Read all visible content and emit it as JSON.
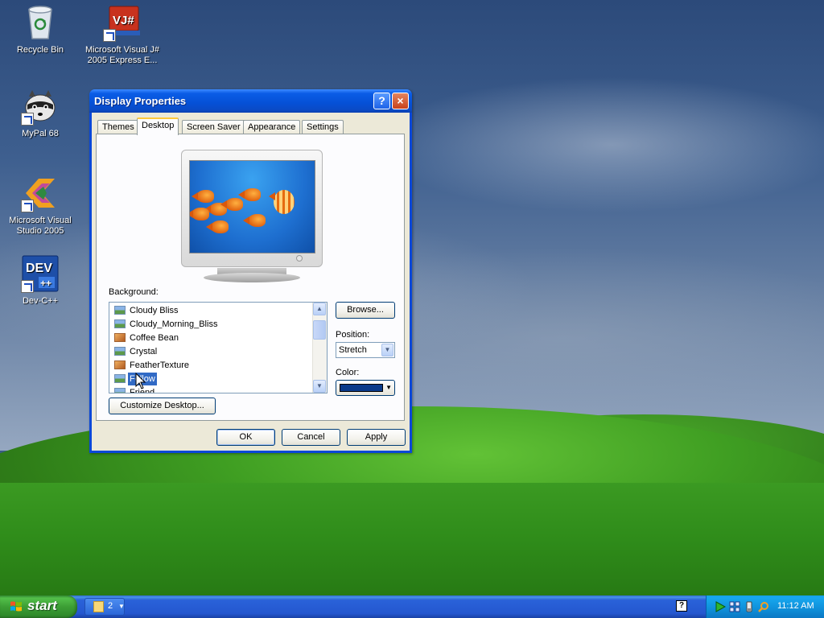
{
  "desktop": {
    "icons": [
      {
        "label": "Recycle Bin"
      },
      {
        "label": "Microsoft Visual J# 2005 Express E..."
      },
      {
        "label": "MyPal 68"
      },
      {
        "label": "Microsoft Visual Studio 2005"
      },
      {
        "label": "Dev-C++"
      }
    ]
  },
  "dialog": {
    "title": "Display Properties",
    "help_glyph": "?",
    "close_glyph": "×",
    "tabs": [
      "Themes",
      "Desktop",
      "Screen Saver",
      "Appearance",
      "Settings"
    ],
    "active_tab": "Desktop",
    "background_label": "Background:",
    "background_items": [
      {
        "name": "Cloudy Bliss",
        "thumb": "blue"
      },
      {
        "name": "Cloudy_Morning_Bliss",
        "thumb": "blue"
      },
      {
        "name": "Coffee Bean",
        "thumb": "warm"
      },
      {
        "name": "Crystal",
        "thumb": "blue"
      },
      {
        "name": "FeatherTexture",
        "thumb": "warm"
      },
      {
        "name": "Follow",
        "thumb": "blue",
        "selected": true
      },
      {
        "name": "Friend",
        "thumb": "blue"
      }
    ],
    "browse_label": "Browse...",
    "position_label": "Position:",
    "position_value": "Stretch",
    "color_label": "Color:",
    "color_value": "#0a3a8a",
    "customize_label": "Customize Desktop...",
    "ok_label": "OK",
    "cancel_label": "Cancel",
    "apply_label": "Apply"
  },
  "taskbar": {
    "start_label": "start",
    "group_count": "2",
    "help_glyph": "?",
    "clock": "11:12 AM"
  }
}
